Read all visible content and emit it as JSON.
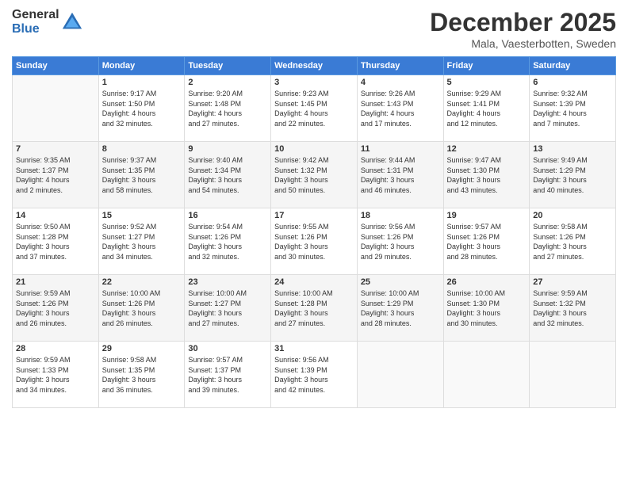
{
  "header": {
    "logo_general": "General",
    "logo_blue": "Blue",
    "month_title": "December 2025",
    "location": "Mala, Vaesterbotten, Sweden"
  },
  "days_of_week": [
    "Sunday",
    "Monday",
    "Tuesday",
    "Wednesday",
    "Thursday",
    "Friday",
    "Saturday"
  ],
  "weeks": [
    [
      {
        "day": "",
        "info": ""
      },
      {
        "day": "1",
        "info": "Sunrise: 9:17 AM\nSunset: 1:50 PM\nDaylight: 4 hours\nand 32 minutes."
      },
      {
        "day": "2",
        "info": "Sunrise: 9:20 AM\nSunset: 1:48 PM\nDaylight: 4 hours\nand 27 minutes."
      },
      {
        "day": "3",
        "info": "Sunrise: 9:23 AM\nSunset: 1:45 PM\nDaylight: 4 hours\nand 22 minutes."
      },
      {
        "day": "4",
        "info": "Sunrise: 9:26 AM\nSunset: 1:43 PM\nDaylight: 4 hours\nand 17 minutes."
      },
      {
        "day": "5",
        "info": "Sunrise: 9:29 AM\nSunset: 1:41 PM\nDaylight: 4 hours\nand 12 minutes."
      },
      {
        "day": "6",
        "info": "Sunrise: 9:32 AM\nSunset: 1:39 PM\nDaylight: 4 hours\nand 7 minutes."
      }
    ],
    [
      {
        "day": "7",
        "info": "Sunrise: 9:35 AM\nSunset: 1:37 PM\nDaylight: 4 hours\nand 2 minutes."
      },
      {
        "day": "8",
        "info": "Sunrise: 9:37 AM\nSunset: 1:35 PM\nDaylight: 3 hours\nand 58 minutes."
      },
      {
        "day": "9",
        "info": "Sunrise: 9:40 AM\nSunset: 1:34 PM\nDaylight: 3 hours\nand 54 minutes."
      },
      {
        "day": "10",
        "info": "Sunrise: 9:42 AM\nSunset: 1:32 PM\nDaylight: 3 hours\nand 50 minutes."
      },
      {
        "day": "11",
        "info": "Sunrise: 9:44 AM\nSunset: 1:31 PM\nDaylight: 3 hours\nand 46 minutes."
      },
      {
        "day": "12",
        "info": "Sunrise: 9:47 AM\nSunset: 1:30 PM\nDaylight: 3 hours\nand 43 minutes."
      },
      {
        "day": "13",
        "info": "Sunrise: 9:49 AM\nSunset: 1:29 PM\nDaylight: 3 hours\nand 40 minutes."
      }
    ],
    [
      {
        "day": "14",
        "info": "Sunrise: 9:50 AM\nSunset: 1:28 PM\nDaylight: 3 hours\nand 37 minutes."
      },
      {
        "day": "15",
        "info": "Sunrise: 9:52 AM\nSunset: 1:27 PM\nDaylight: 3 hours\nand 34 minutes."
      },
      {
        "day": "16",
        "info": "Sunrise: 9:54 AM\nSunset: 1:26 PM\nDaylight: 3 hours\nand 32 minutes."
      },
      {
        "day": "17",
        "info": "Sunrise: 9:55 AM\nSunset: 1:26 PM\nDaylight: 3 hours\nand 30 minutes."
      },
      {
        "day": "18",
        "info": "Sunrise: 9:56 AM\nSunset: 1:26 PM\nDaylight: 3 hours\nand 29 minutes."
      },
      {
        "day": "19",
        "info": "Sunrise: 9:57 AM\nSunset: 1:26 PM\nDaylight: 3 hours\nand 28 minutes."
      },
      {
        "day": "20",
        "info": "Sunrise: 9:58 AM\nSunset: 1:26 PM\nDaylight: 3 hours\nand 27 minutes."
      }
    ],
    [
      {
        "day": "21",
        "info": "Sunrise: 9:59 AM\nSunset: 1:26 PM\nDaylight: 3 hours\nand 26 minutes."
      },
      {
        "day": "22",
        "info": "Sunrise: 10:00 AM\nSunset: 1:26 PM\nDaylight: 3 hours\nand 26 minutes."
      },
      {
        "day": "23",
        "info": "Sunrise: 10:00 AM\nSunset: 1:27 PM\nDaylight: 3 hours\nand 27 minutes."
      },
      {
        "day": "24",
        "info": "Sunrise: 10:00 AM\nSunset: 1:28 PM\nDaylight: 3 hours\nand 27 minutes."
      },
      {
        "day": "25",
        "info": "Sunrise: 10:00 AM\nSunset: 1:29 PM\nDaylight: 3 hours\nand 28 minutes."
      },
      {
        "day": "26",
        "info": "Sunrise: 10:00 AM\nSunset: 1:30 PM\nDaylight: 3 hours\nand 30 minutes."
      },
      {
        "day": "27",
        "info": "Sunrise: 9:59 AM\nSunset: 1:32 PM\nDaylight: 3 hours\nand 32 minutes."
      }
    ],
    [
      {
        "day": "28",
        "info": "Sunrise: 9:59 AM\nSunset: 1:33 PM\nDaylight: 3 hours\nand 34 minutes."
      },
      {
        "day": "29",
        "info": "Sunrise: 9:58 AM\nSunset: 1:35 PM\nDaylight: 3 hours\nand 36 minutes."
      },
      {
        "day": "30",
        "info": "Sunrise: 9:57 AM\nSunset: 1:37 PM\nDaylight: 3 hours\nand 39 minutes."
      },
      {
        "day": "31",
        "info": "Sunrise: 9:56 AM\nSunset: 1:39 PM\nDaylight: 3 hours\nand 42 minutes."
      },
      {
        "day": "",
        "info": ""
      },
      {
        "day": "",
        "info": ""
      },
      {
        "day": "",
        "info": ""
      }
    ]
  ]
}
